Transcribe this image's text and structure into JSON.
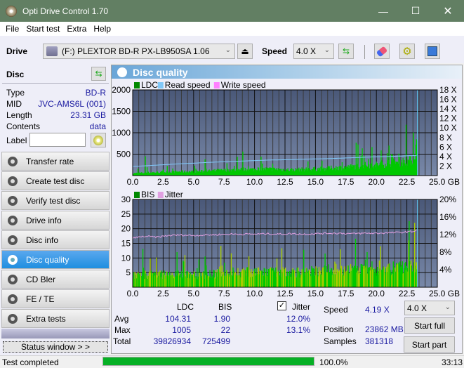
{
  "window": {
    "title": "Opti Drive Control 1.70",
    "controls": [
      "minimize",
      "maximize",
      "close"
    ]
  },
  "menu": [
    {
      "label": "File"
    },
    {
      "label": "Start test"
    },
    {
      "label": "Extra"
    },
    {
      "label": "Help"
    }
  ],
  "toolbar": {
    "drive_label": "Drive",
    "drive_value": "(F:)  PLEXTOR BD-R  PX-LB950SA 1.06",
    "speed_label": "Speed",
    "speed_value": "4.0 X",
    "icons": [
      "drive-icon",
      "eject-icon",
      "refresh-icon",
      "erase-icon",
      "settings-icon",
      "save-icon"
    ]
  },
  "disc": {
    "header": "Disc",
    "rows": [
      {
        "label": "Type",
        "value": "BD-R"
      },
      {
        "label": "MID",
        "value": "JVC-AMS6L (001)"
      },
      {
        "label": "Length",
        "value": "23.31 GB"
      },
      {
        "label": "Contents",
        "value": "data"
      }
    ],
    "label_field_label": "Label",
    "label_field_value": ""
  },
  "nav": [
    {
      "label": "Transfer rate",
      "active": false
    },
    {
      "label": "Create test disc",
      "active": false
    },
    {
      "label": "Verify test disc",
      "active": false
    },
    {
      "label": "Drive info",
      "active": false
    },
    {
      "label": "Disc info",
      "active": false
    },
    {
      "label": "Disc quality",
      "active": true
    },
    {
      "label": "CD Bler",
      "active": false
    },
    {
      "label": "FE / TE",
      "active": false
    },
    {
      "label": "Extra tests",
      "active": false
    }
  ],
  "status_window_btn": "Status window > >",
  "panel_title": "Disc quality",
  "chart_data": [
    {
      "type": "area",
      "title": "LDC / Read speed",
      "legend": [
        "LDC",
        "Read speed",
        "Write speed"
      ],
      "colors": {
        "LDC": "#00c800",
        "Read speed": "#80c8f8",
        "Write speed": "#ff80ff"
      },
      "xlabel": "GB",
      "x_ticks": [
        "0.0",
        "2.5",
        "5.0",
        "7.5",
        "10.0",
        "12.5",
        "15.0",
        "17.5",
        "20.0",
        "22.5",
        "25.0"
      ],
      "xlim": [
        0,
        25
      ],
      "y_ticks": [
        "500",
        "1000",
        "1500",
        "2000"
      ],
      "ylim": [
        0,
        2000
      ],
      "y2_ticks": [
        "2 X",
        "4 X",
        "6 X",
        "8 X",
        "10 X",
        "12 X",
        "14 X",
        "16 X",
        "18 X"
      ],
      "y2lim": [
        0,
        18
      ],
      "ldc_x": [
        0,
        1,
        2,
        3,
        4,
        5,
        6,
        7,
        8,
        9,
        10,
        11,
        12,
        13,
        14,
        15,
        16,
        17,
        18,
        19,
        20,
        21,
        22,
        23,
        23.31
      ],
      "ldc_base": [
        60,
        80,
        90,
        100,
        110,
        110,
        120,
        140,
        150,
        170,
        170,
        180,
        170,
        160,
        170,
        180,
        200,
        220,
        240,
        280,
        300,
        340,
        380,
        420,
        900
      ],
      "ldc_peaks": [
        {
          "x": 1.0,
          "y": 450
        },
        {
          "x": 5.9,
          "y": 380
        },
        {
          "x": 9.0,
          "y": 560
        },
        {
          "x": 10.5,
          "y": 440
        },
        {
          "x": 21.0,
          "y": 700
        },
        {
          "x": 23.0,
          "y": 1005
        }
      ],
      "read_speed_x": [
        0,
        1,
        2,
        3,
        4,
        5,
        6,
        7,
        8,
        9,
        10,
        11,
        12,
        13,
        14,
        15,
        16,
        17,
        18,
        19,
        20,
        21,
        22,
        23,
        23.31
      ],
      "read_speed": [
        1.9,
        2.05,
        2.2,
        2.35,
        2.5,
        2.6,
        2.75,
        2.85,
        2.95,
        3.05,
        3.15,
        3.25,
        3.3,
        3.35,
        3.45,
        3.5,
        3.55,
        3.65,
        3.75,
        3.85,
        3.95,
        4.0,
        4.1,
        4.19,
        4.19
      ]
    },
    {
      "type": "area",
      "title": "BIS / Jitter",
      "legend": [
        "BIS",
        "Jitter"
      ],
      "colors": {
        "BIS": "#00c800",
        "Jitter": "#e0a0e0"
      },
      "xlabel": "GB",
      "x_ticks": [
        "0.0",
        "2.5",
        "5.0",
        "7.5",
        "10.0",
        "12.5",
        "15.0",
        "17.5",
        "20.0",
        "22.5",
        "25.0"
      ],
      "xlim": [
        0,
        25
      ],
      "y_ticks": [
        "5",
        "10",
        "15",
        "20",
        "25",
        "30"
      ],
      "ylim": [
        0,
        30
      ],
      "y2_ticks": [
        "4%",
        "8%",
        "12%",
        "16%",
        "20%"
      ],
      "y2lim": [
        0,
        20
      ],
      "bis_x": [
        0,
        2,
        4,
        6,
        8,
        10,
        12,
        14,
        16,
        18,
        20,
        22,
        23.31
      ],
      "bis_base": [
        5,
        5,
        5,
        5,
        6,
        6,
        6,
        6,
        7,
        7,
        7,
        8,
        8
      ],
      "bis_peaks": [
        {
          "x": 3.6,
          "y": 12
        },
        {
          "x": 17.0,
          "y": 13
        },
        {
          "x": 20.3,
          "y": 14
        },
        {
          "x": 22.6,
          "y": 16
        },
        {
          "x": 23.1,
          "y": 22
        }
      ],
      "jitter_x": [
        0,
        1,
        2,
        3,
        4,
        5,
        6,
        7,
        8,
        9,
        10,
        11,
        12,
        13,
        14,
        15,
        16,
        17,
        18,
        19,
        20,
        21,
        22,
        23,
        23.31
      ],
      "jitter": [
        11.2,
        11.6,
        11.4,
        11.8,
        11.9,
        11.8,
        11.9,
        12.0,
        12.1,
        12.1,
        12.1,
        12.2,
        12.1,
        12.2,
        12.1,
        12.2,
        12.3,
        12.3,
        12.2,
        12.3,
        12.3,
        12.4,
        12.5,
        12.7,
        13.1
      ]
    }
  ],
  "stats": {
    "headers": [
      "LDC",
      "BIS"
    ],
    "rows": [
      {
        "label": "Avg",
        "ldc": "104.31",
        "bis": "1.90",
        "jitter": "12.0%"
      },
      {
        "label": "Max",
        "ldc": "1005",
        "bis": "22",
        "jitter": "13.1%"
      },
      {
        "label": "Total",
        "ldc": "39826934",
        "bis": "725499"
      }
    ],
    "jitter_checked": true,
    "jitter_label": "Jitter",
    "speed_label": "Speed",
    "speed_value": "4.19 X",
    "position_label": "Position",
    "position_value": "23862 MB",
    "samples_label": "Samples",
    "samples_value": "381318",
    "speed_select": "4.0 X",
    "start_full": "Start full",
    "start_part": "Start part"
  },
  "statusbar": {
    "text": "Test completed",
    "progress_percent": 100,
    "progress_text": "100.0%",
    "time": "33:13"
  }
}
